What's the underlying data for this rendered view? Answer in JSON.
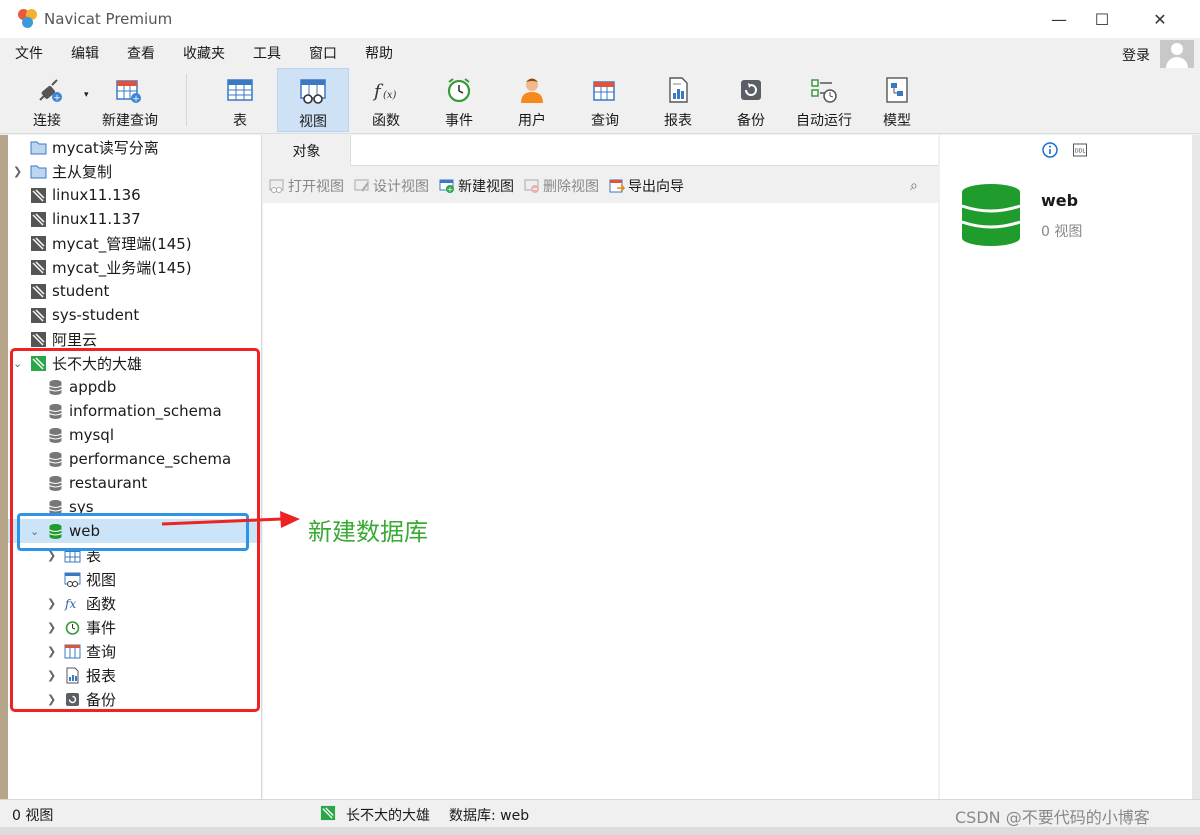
{
  "window": {
    "title": "Navicat Premium",
    "minimize": "—",
    "maximize": "☐",
    "close": "✕"
  },
  "menu": [
    "文件",
    "编辑",
    "查看",
    "收藏夹",
    "工具",
    "窗口",
    "帮助"
  ],
  "login": "登录",
  "toolbar": {
    "connect": "连接",
    "new_query": "新建查询",
    "table": "表",
    "view": "视图",
    "function": "函数",
    "event": "事件",
    "user": "用户",
    "query": "查询",
    "report": "报表",
    "backup": "备份",
    "automation": "自动运行",
    "model": "模型"
  },
  "connections": [
    "mycat读写分离",
    "主从复制",
    "linux11.136",
    "linux11.137",
    "mycat_管理端(145)",
    "mycat_业务端(145)",
    "student",
    "sys-student",
    "阿里云",
    "长不大的大雄"
  ],
  "databases": [
    "appdb",
    "information_schema",
    "mysql",
    "performance_schema",
    "restaurant",
    "sys",
    "web"
  ],
  "web_children": [
    "表",
    "视图",
    "函数",
    "事件",
    "查询",
    "报表",
    "备份"
  ],
  "tabs": {
    "objects": "对象"
  },
  "object_toolbar": {
    "open_view": "打开视图",
    "design_view": "设计视图",
    "new_view": "新建视图",
    "delete_view": "删除视图",
    "export_wizard": "导出向导"
  },
  "info_panel": {
    "db_name": "web",
    "view_count": "0 视图"
  },
  "status": {
    "left": "0 视图",
    "connection": "长不大的大雄",
    "database": "数据库: web"
  },
  "annotation": "新建数据库",
  "watermark": "CSDN @不要代码的小博客",
  "colors": {
    "accent_selected": "#cce4f7",
    "red_annotation": "#ee2222",
    "blue_annotation": "#2f93e6",
    "green_text": "#3aaa35",
    "db_green": "#1f9c2c"
  }
}
